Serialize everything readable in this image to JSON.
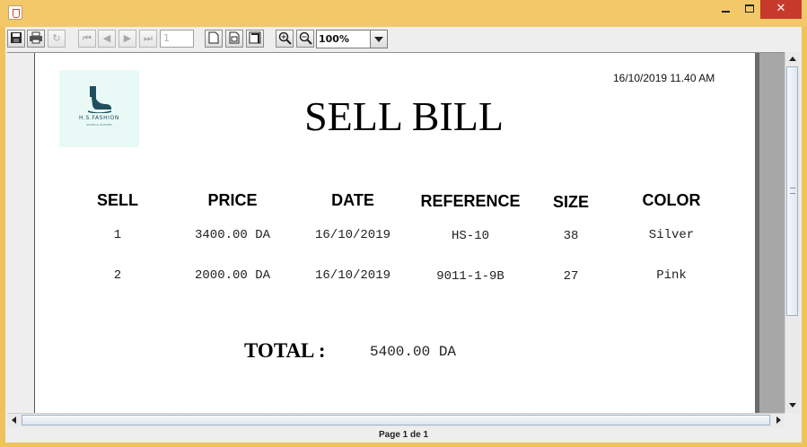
{
  "window": {
    "title": ""
  },
  "toolbar": {
    "page_number": "1",
    "zoom": "100%",
    "icons": [
      "save-icon",
      "print-icon",
      "reload-icon",
      "first-page-icon",
      "previous-page-icon",
      "next-page-icon",
      "last-page-icon",
      "actual-size-icon",
      "fit-page-icon",
      "fit-width-icon",
      "zoom-in-icon",
      "zoom-out-icon"
    ]
  },
  "report": {
    "datetime": "16/10/2019 11.40 AM",
    "title": "SELL BILL",
    "logo": {
      "name": "H.S.FASHION",
      "tagline": "SHOES & CLOTHES"
    },
    "columns": [
      "SELL",
      "PRICE",
      "DATE",
      "REFERENCE",
      "SIZE",
      "COLOR"
    ],
    "rows": [
      [
        "1",
        "3400.00 DA",
        "16/10/2019",
        "HS-10",
        "38",
        "Silver"
      ],
      [
        "2",
        "2000.00 DA",
        "16/10/2019",
        "9011-1-9B",
        "27",
        "Pink"
      ]
    ],
    "total_label": "TOTAL :",
    "total_value": "5400.00 DA"
  },
  "status": {
    "page_text": "Page 1 de 1"
  }
}
